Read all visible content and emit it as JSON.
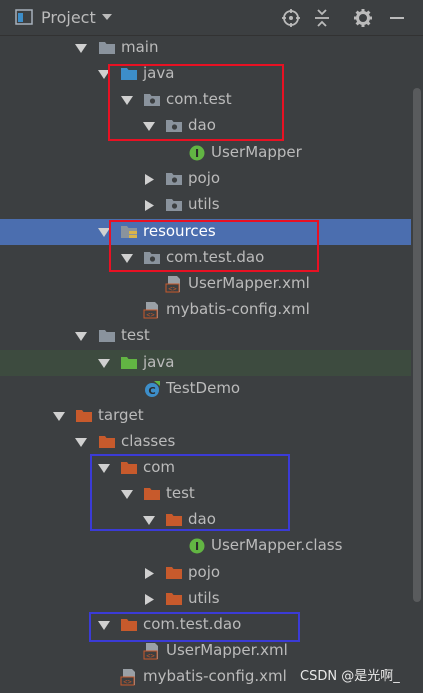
{
  "header": {
    "title": "Project",
    "icons": [
      "project-icon",
      "dropdown-caret-icon",
      "locate-icon",
      "collapse-all-icon",
      "settings-gear-icon",
      "hide-icon"
    ]
  },
  "tree": {
    "rows": [
      {
        "label": "main",
        "expanded": true,
        "icon": "folder"
      },
      {
        "label": "java",
        "expanded": true,
        "icon": "source-folder"
      },
      {
        "label": "com.test",
        "expanded": true,
        "icon": "package"
      },
      {
        "label": "dao",
        "expanded": true,
        "icon": "package"
      },
      {
        "label": "UserMapper",
        "icon": "interface"
      },
      {
        "label": "pojo",
        "expanded": false,
        "icon": "package"
      },
      {
        "label": "utils",
        "expanded": false,
        "icon": "package"
      },
      {
        "label": "resources",
        "expanded": true,
        "icon": "resources-folder",
        "selected": true
      },
      {
        "label": "com.test.dao",
        "expanded": true,
        "icon": "package"
      },
      {
        "label": "UserMapper.xml",
        "icon": "xml-file"
      },
      {
        "label": "mybatis-config.xml",
        "icon": "xml-file"
      },
      {
        "label": "test",
        "expanded": true,
        "icon": "folder"
      },
      {
        "label": "java",
        "expanded": true,
        "icon": "test-source-folder"
      },
      {
        "label": "TestDemo",
        "icon": "test-class"
      },
      {
        "label": "target",
        "expanded": true,
        "icon": "excluded-folder"
      },
      {
        "label": "classes",
        "expanded": true,
        "icon": "excluded-folder"
      },
      {
        "label": "com",
        "expanded": true,
        "icon": "excluded-folder"
      },
      {
        "label": "test",
        "expanded": true,
        "icon": "excluded-folder"
      },
      {
        "label": "dao",
        "expanded": true,
        "icon": "excluded-folder"
      },
      {
        "label": "UserMapper.class",
        "icon": "interface"
      },
      {
        "label": "pojo",
        "expanded": false,
        "icon": "excluded-folder"
      },
      {
        "label": "utils",
        "expanded": false,
        "icon": "excluded-folder"
      },
      {
        "label": "com.test.dao",
        "expanded": true,
        "icon": "excluded-folder"
      },
      {
        "label": "UserMapper.xml",
        "icon": "xml-file"
      },
      {
        "label": "mybatis-config.xml",
        "icon": "xml-file"
      }
    ]
  },
  "highlights": [
    {
      "color": "red",
      "covers": [
        "java",
        "com.test",
        "dao"
      ]
    },
    {
      "color": "red",
      "covers": [
        "resources",
        "com.test.dao"
      ]
    },
    {
      "color": "blue",
      "covers": [
        "com",
        "test",
        "dao"
      ]
    },
    {
      "color": "blue",
      "covers": [
        "com.test.dao"
      ]
    }
  ],
  "watermark": "CSDN @是光啊_",
  "colors": {
    "background": "#3c3f41",
    "selected": "#4b6eaf",
    "test_row": "#3d4b3f",
    "folder_gray": "#8a939d",
    "source_blue": "#3d8ec9",
    "test_green": "#62b543",
    "excluded_orange": "#c75a2c",
    "interface_green": "#62b543",
    "highlight_red": "#e81123",
    "highlight_blue": "#3b3bd6"
  }
}
